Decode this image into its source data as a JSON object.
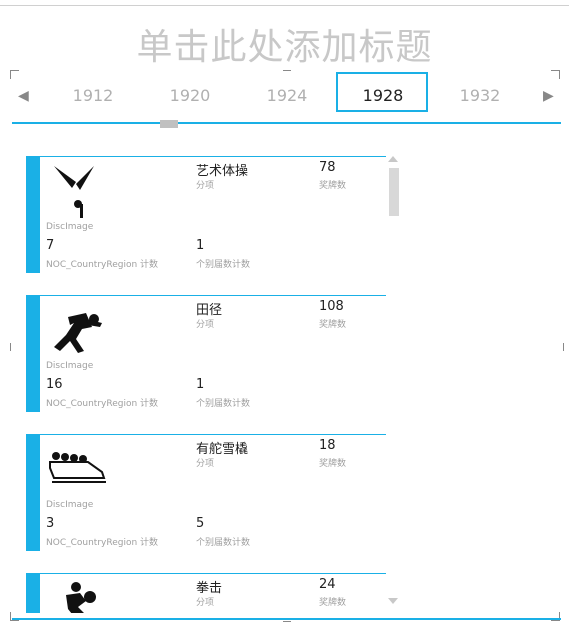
{
  "title": "单击此处添加标题",
  "timeline": {
    "years": [
      "1912",
      "1920",
      "1924",
      "1928",
      "1932"
    ],
    "selected_year": "1928",
    "prev_icon": "triangle-left-icon",
    "next_icon": "triangle-right-icon"
  },
  "accent_color": "#1ab0e6",
  "cards": [
    {
      "image_label": "DiscImage",
      "icon": "rhythmic-gymnastics-icon",
      "discipline": "艺术体操",
      "discipline_caption": "分项",
      "medals": "78",
      "medals_caption": "奖牌数",
      "noc_count": "7",
      "noc_caption": "NOC_CountryRegion 计数",
      "distinct_count": "1",
      "distinct_caption": "个别届数计数"
    },
    {
      "image_label": "DiscImage",
      "icon": "athletics-icon",
      "discipline": "田径",
      "discipline_caption": "分项",
      "medals": "108",
      "medals_caption": "奖牌数",
      "noc_count": "16",
      "noc_caption": "NOC_CountryRegion 计数",
      "distinct_count": "1",
      "distinct_caption": "个别届数计数"
    },
    {
      "image_label": "DiscImage",
      "icon": "bobsleigh-icon",
      "discipline": "有舵雪橇",
      "discipline_caption": "分项",
      "medals": "18",
      "medals_caption": "奖牌数",
      "noc_count": "3",
      "noc_caption": "NOC_CountryRegion 计数",
      "distinct_count": "5",
      "distinct_caption": "个别届数计数"
    },
    {
      "image_label": "",
      "icon": "boxing-icon",
      "discipline": "拳击",
      "discipline_caption": "分项",
      "medals": "24",
      "medals_caption": "奖牌数"
    }
  ]
}
